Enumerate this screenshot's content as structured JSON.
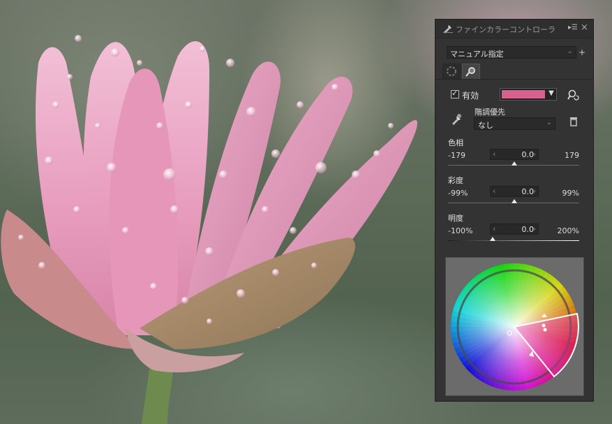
{
  "panel": {
    "title": "ファインカラーコントローラ",
    "preset": "マニュアル指定",
    "plus_label": "+",
    "enabled_label": "有効",
    "selected_color": "#d8628f",
    "tone_priority_label": "階調優先",
    "tone_priority_value": "なし",
    "sliders": [
      {
        "label": "色相",
        "min": "-179",
        "max": "179",
        "value": "0.0",
        "position": 0.5
      },
      {
        "label": "彩度",
        "min": "-99%",
        "max": "99%",
        "value": "0.0",
        "position": 0.5
      },
      {
        "label": "明度",
        "min": "-100%",
        "max": "200%",
        "value": "0.0",
        "position": 0.333
      }
    ]
  },
  "icons": {
    "panel_icon": "eyedropper-pen-icon",
    "menu": "panel-menu-icon",
    "close": "close-icon",
    "tab1": "color-wheel-tab-icon",
    "tab2": "eyedropper-tab-icon",
    "pick": "eyedropper-reset-icon",
    "tone": "tone-eyedropper-icon",
    "trash": "trash-icon"
  }
}
